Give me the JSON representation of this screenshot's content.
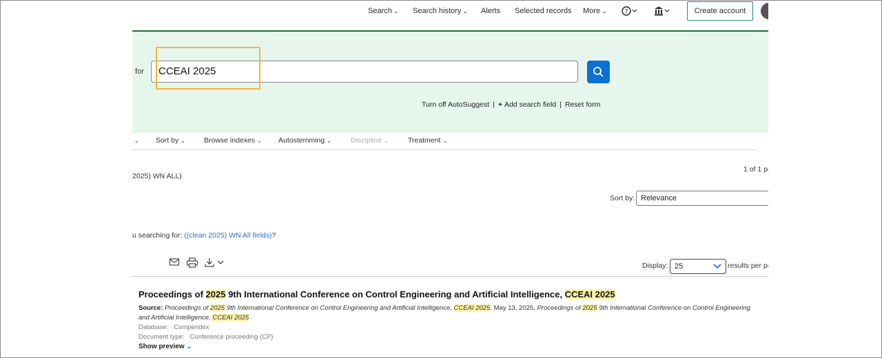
{
  "nav": {
    "search": "Search",
    "search_history": "Search history",
    "alerts": "Alerts",
    "selected_records": "Selected records",
    "more": "More",
    "create_account": "Create account"
  },
  "search": {
    "for_label": "for",
    "value": "CCEAI 2025",
    "turn_off_autosuggest": "Turn off AutoSuggest",
    "add_search_field": "Add search field",
    "reset_form": "Reset form"
  },
  "toolbar": {
    "sort_by": "Sort by",
    "browse_indexes": "Browse indexes",
    "autostemming": "Autostemming",
    "discipline": "Discipline",
    "treatment": "Treatment"
  },
  "results": {
    "query": "2025) WN ALL)",
    "page_count": "1 of 1 pa",
    "sort_label": "Sort by:",
    "sort_value": "Relevance",
    "did_you_mean_prefix": "u searching for:",
    "did_you_mean_link": "((clean 2025) WN All fields)",
    "did_you_mean_suffix": "?",
    "display_label": "Display:",
    "display_value": "25",
    "results_per": "results per pa"
  },
  "record": {
    "title_parts": [
      "Proceedings of ",
      "2025",
      " 9th International Conference on Control Engineering and Artificial Intelligence, ",
      "CCEAI 2025"
    ],
    "source_label": "Source:",
    "source_parts": [
      "Proceedings of ",
      "2025",
      " 9th International Conference on Control Engineering and Artificial Intelligence, ",
      "CCEAI 2025",
      ", May 13, 2025, ",
      "Proceedings of ",
      "2025",
      " 9th International Conference on Control Engineering and Artificial Intelligence, ",
      "CCEAI 2025"
    ],
    "database_label": "Database:",
    "database_value": "Compendex",
    "doctype_label": "Document type:",
    "doctype_value": "Conference proceeding (CP)",
    "show_preview": "Show preview"
  },
  "colors": {
    "band_bg": "#e6f6ec",
    "search_button": "#0b6fd6",
    "highlight": "#fff3a6",
    "annotation_box": "#f4b63a"
  }
}
